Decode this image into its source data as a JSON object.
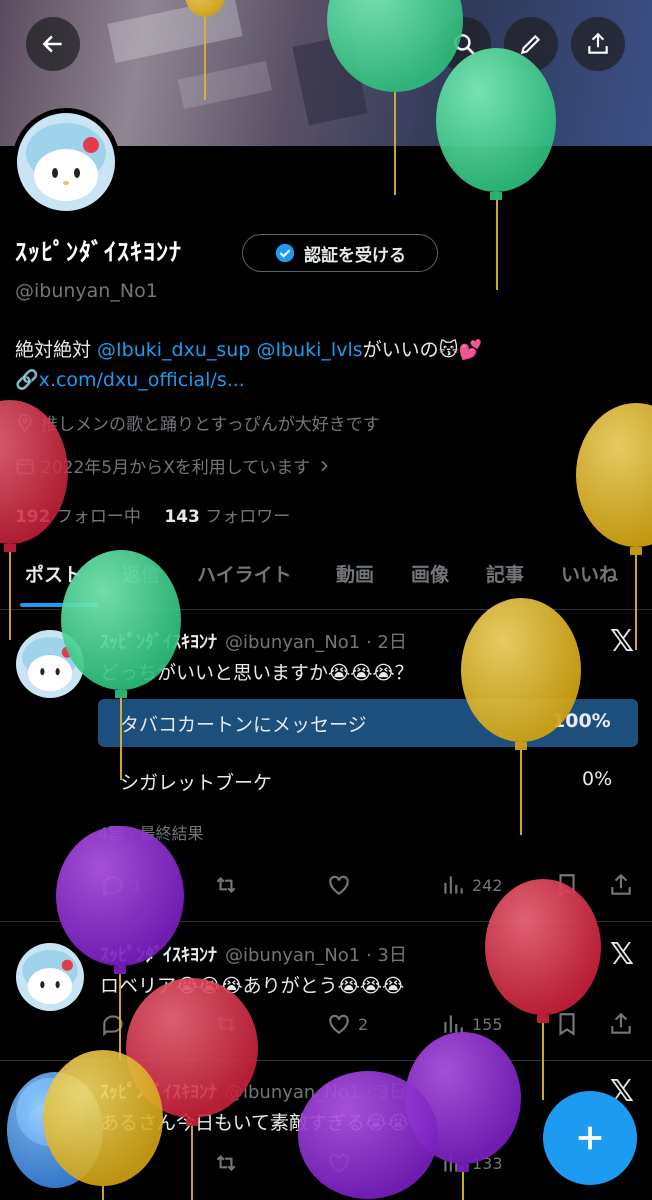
{
  "header": {
    "back_icon": "arrow-left-icon",
    "search_icon": "search-icon",
    "edit_icon": "pencil-icon",
    "share_icon": "share-icon"
  },
  "profile": {
    "display_name": "ｽｯﾋﾟﾝﾀﾞｲｽｷﾖﾝﾅ",
    "verify_button": "認証を受ける",
    "handle": "@ibunyan_No1",
    "bio_prefix": "絶対絶対 ",
    "bio_mention1": "@Ibuki_dxu_sup",
    "bio_mention2": "@Ibuki_lvls",
    "bio_suffix": "がいいの😽💕",
    "link_emoji": "🔗",
    "link": "x.com/dxu_official/s...",
    "location": "推しメンの歌と踊りとすっぴんが大好きです",
    "joined": "2022年5月からXを利用しています",
    "following_count": "192",
    "following_label": "フォロー中",
    "followers_count": "143",
    "followers_label": "フォロワー"
  },
  "tabs": [
    "ポスト",
    "返信",
    "ハイライト",
    "動画",
    "画像",
    "記事",
    "いいね"
  ],
  "posts": [
    {
      "name": "ｽｯﾋﾟﾝﾀﾞｲｽｷﾖﾝﾅ",
      "meta": "@ibunyan_No1 · 2日",
      "text": "どっちがいいと思いますか😭😭😭？",
      "poll": {
        "options": [
          {
            "label": "タバコカートンにメッセージ",
            "percent": "100%",
            "fraction": 1.0
          },
          {
            "label": "シガレットブーケ",
            "percent": "0%",
            "fraction": 0.0
          }
        ],
        "summary": "4票 · 最終結果"
      },
      "replies": "1",
      "views": "242"
    },
    {
      "name": "ｽｯﾋﾟﾝﾀﾞｲｽｷﾖﾝﾅ",
      "meta": "@ibunyan_No1 · 3日",
      "text": "ロベリア😭😭😭ありがとう😭😭😭",
      "likes": "2",
      "views": "155"
    },
    {
      "name": "ｽｯﾋﾟﾝﾀﾞｲｽｷﾖﾝﾅ",
      "meta": "@ibunyan_No1 · 3日",
      "text": "あるさん今日もいて素敵すぎる😭😭😭",
      "views": "133"
    }
  ],
  "x_logo": "𝕏",
  "fab_icon": "plus-icon",
  "colors": {
    "accent": "#1d9bf0",
    "poll_bar": "#1d4f7c",
    "background": "#000000"
  }
}
